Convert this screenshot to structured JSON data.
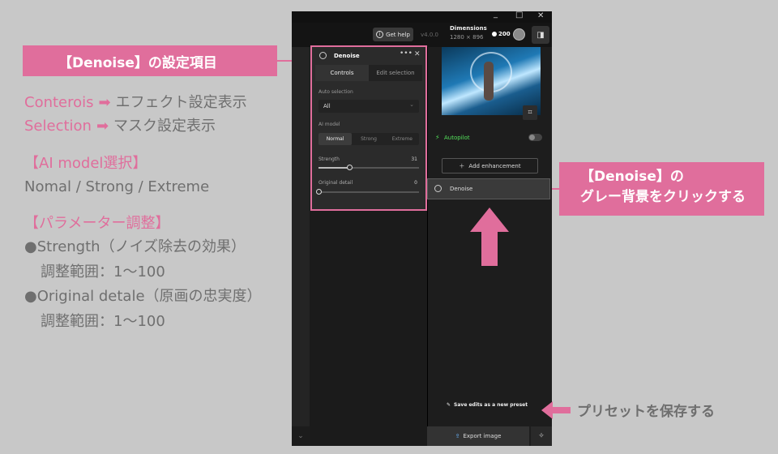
{
  "annotation": {
    "title_banner": "【Denoise】の設定項目",
    "tab_notes": [
      {
        "label": "Conterois",
        "arrow": "➡",
        "desc": "エフェクト設定表示"
      },
      {
        "label": "Selection",
        "arrow": "➡",
        "desc": "マスク設定表示"
      }
    ],
    "model_heading": "【AI model選択】",
    "model_options": "Nomal / Strong / Extreme",
    "param_heading": "【パラメーター調整】",
    "param1": "●Strength（ノイズ除去の効果）",
    "param1_range": "調整範囲：1〜100",
    "param2": "●Original detale（原画の忠実度）",
    "param2_range": "調整範囲：1〜100",
    "click_callout_line1": "【Denoise】の",
    "click_callout_line2": "グレー背景をクリックする",
    "preset_callout": "プリセットを保存する"
  },
  "toolbar": {
    "help": "Get help",
    "version": "v4.0.0",
    "dimensions_label": "Dimensions",
    "dimensions_value": "1280 × 896",
    "credits": "200"
  },
  "popup": {
    "title": "Denoise",
    "more": "•••",
    "close": "✕",
    "tabs": [
      "Controls",
      "Edit selection"
    ],
    "auto_selection_label": "Auto selection",
    "auto_selection_value": "All",
    "ai_model_label": "AI model",
    "models": [
      "Normal",
      "Strong",
      "Extreme"
    ],
    "selected_model": "Normal",
    "strength_label": "Strength",
    "strength_value": "31",
    "strength_fraction": 0.31,
    "original_detail_label": "Original detail",
    "original_detail_value": "0",
    "original_detail_fraction": 0.0
  },
  "right_panel": {
    "autopilot_label": "Autopilot",
    "autopilot_on": false,
    "add_enhancement": "Add enhancement",
    "enhancement_item": "Denoise",
    "save_preset": "Save edits as a new preset",
    "export": "Export image"
  },
  "window_controls": [
    "_",
    "□",
    "✕"
  ],
  "colors": {
    "accent": "#e06e9c",
    "autopilot": "#53e05a"
  }
}
